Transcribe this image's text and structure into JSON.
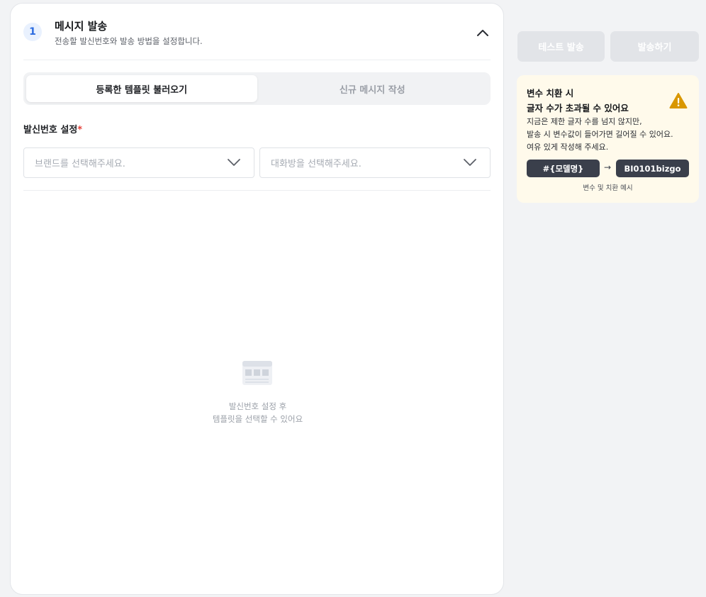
{
  "step": {
    "number": "1",
    "title": "메시지 발송",
    "subtitle": "전송할 발신번호와 발송 방법을 설정합니다."
  },
  "tabs": [
    {
      "label": "등록한 템플릿 불러오기",
      "active": true
    },
    {
      "label": "신규 메시지 작성",
      "active": false
    }
  ],
  "sender": {
    "label": "발신번호 설정",
    "required_mark": "*",
    "brand_placeholder": "브랜드를 선택해주세요.",
    "chatroom_placeholder": "대화방을 선택해주세요."
  },
  "empty_state": {
    "icon": "template-list-icon",
    "line1": "발신번호 설정 후",
    "line2": "템플릿을 선택할 수 있어요"
  },
  "actions": {
    "test_send": "테스트 발송",
    "send": "발송하기"
  },
  "tip": {
    "title_line1": "변수 치환 시",
    "title_line2": "글자 수가 초과될 수 있어요",
    "body_line1": "지금은 제한 글자 수를 넘지 않지만,",
    "body_line2": "발송 시 변수값이 들어가면 길어질 수 있어요.",
    "body_line3": "여유 있게 작성해 주세요.",
    "example_variable": "#{모델명}",
    "example_arrow": "→",
    "example_value": "BI0101bizgo",
    "caption": "변수 및 치환 예시",
    "warning_icon": "warning-triangle-icon",
    "warning_color": "#d99700"
  },
  "colors": {
    "accent": "#2d6ce0",
    "required": "#e5423a",
    "disabled_button": "#e2e4e8",
    "tip_background": "#fffaeb"
  }
}
